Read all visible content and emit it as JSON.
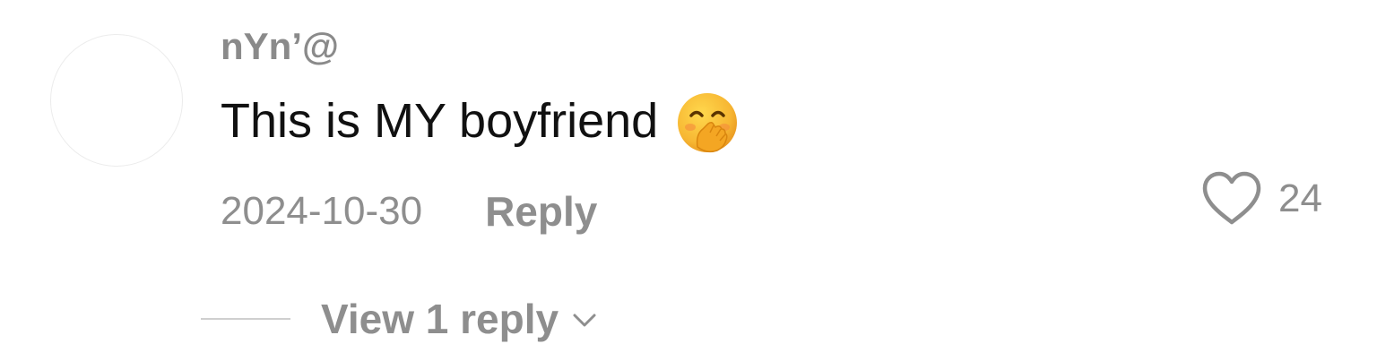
{
  "comment": {
    "username": "nYn’@",
    "text": "This is MY boyfriend",
    "emoji_icon": "face-with-hand-over-mouth-icon",
    "date": "2024-10-30",
    "reply_label": "Reply",
    "like_count": "24",
    "like_icon": "heart-outline-icon",
    "view_replies_label": "View 1 reply"
  },
  "colors": {
    "text_primary": "#111111",
    "text_secondary": "#8e8e8e",
    "emoji_yellow": "#f7b733"
  }
}
